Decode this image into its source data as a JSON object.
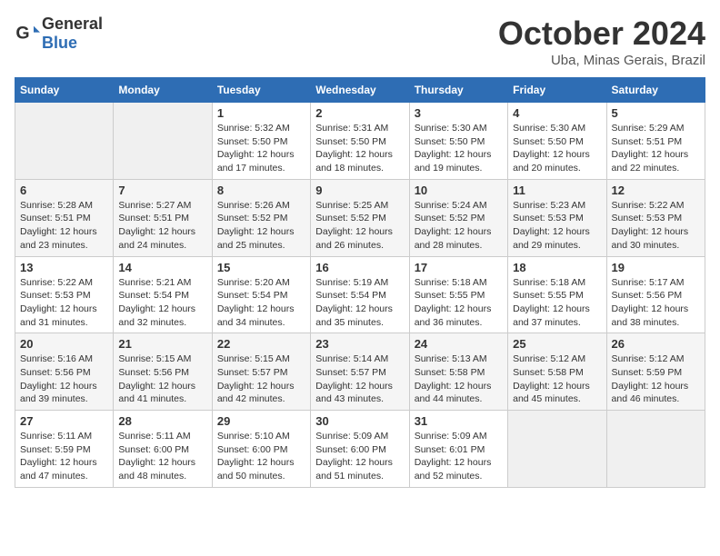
{
  "logo": {
    "line1": "General",
    "line2": "Blue"
  },
  "title": "October 2024",
  "subtitle": "Uba, Minas Gerais, Brazil",
  "days_of_week": [
    "Sunday",
    "Monday",
    "Tuesday",
    "Wednesday",
    "Thursday",
    "Friday",
    "Saturday"
  ],
  "weeks": [
    [
      null,
      null,
      {
        "day": "1",
        "sunrise": "Sunrise: 5:32 AM",
        "sunset": "Sunset: 5:50 PM",
        "daylight": "Daylight: 12 hours and 17 minutes."
      },
      {
        "day": "2",
        "sunrise": "Sunrise: 5:31 AM",
        "sunset": "Sunset: 5:50 PM",
        "daylight": "Daylight: 12 hours and 18 minutes."
      },
      {
        "day": "3",
        "sunrise": "Sunrise: 5:30 AM",
        "sunset": "Sunset: 5:50 PM",
        "daylight": "Daylight: 12 hours and 19 minutes."
      },
      {
        "day": "4",
        "sunrise": "Sunrise: 5:30 AM",
        "sunset": "Sunset: 5:50 PM",
        "daylight": "Daylight: 12 hours and 20 minutes."
      },
      {
        "day": "5",
        "sunrise": "Sunrise: 5:29 AM",
        "sunset": "Sunset: 5:51 PM",
        "daylight": "Daylight: 12 hours and 22 minutes."
      }
    ],
    [
      {
        "day": "6",
        "sunrise": "Sunrise: 5:28 AM",
        "sunset": "Sunset: 5:51 PM",
        "daylight": "Daylight: 12 hours and 23 minutes."
      },
      {
        "day": "7",
        "sunrise": "Sunrise: 5:27 AM",
        "sunset": "Sunset: 5:51 PM",
        "daylight": "Daylight: 12 hours and 24 minutes."
      },
      {
        "day": "8",
        "sunrise": "Sunrise: 5:26 AM",
        "sunset": "Sunset: 5:52 PM",
        "daylight": "Daylight: 12 hours and 25 minutes."
      },
      {
        "day": "9",
        "sunrise": "Sunrise: 5:25 AM",
        "sunset": "Sunset: 5:52 PM",
        "daylight": "Daylight: 12 hours and 26 minutes."
      },
      {
        "day": "10",
        "sunrise": "Sunrise: 5:24 AM",
        "sunset": "Sunset: 5:52 PM",
        "daylight": "Daylight: 12 hours and 28 minutes."
      },
      {
        "day": "11",
        "sunrise": "Sunrise: 5:23 AM",
        "sunset": "Sunset: 5:53 PM",
        "daylight": "Daylight: 12 hours and 29 minutes."
      },
      {
        "day": "12",
        "sunrise": "Sunrise: 5:22 AM",
        "sunset": "Sunset: 5:53 PM",
        "daylight": "Daylight: 12 hours and 30 minutes."
      }
    ],
    [
      {
        "day": "13",
        "sunrise": "Sunrise: 5:22 AM",
        "sunset": "Sunset: 5:53 PM",
        "daylight": "Daylight: 12 hours and 31 minutes."
      },
      {
        "day": "14",
        "sunrise": "Sunrise: 5:21 AM",
        "sunset": "Sunset: 5:54 PM",
        "daylight": "Daylight: 12 hours and 32 minutes."
      },
      {
        "day": "15",
        "sunrise": "Sunrise: 5:20 AM",
        "sunset": "Sunset: 5:54 PM",
        "daylight": "Daylight: 12 hours and 34 minutes."
      },
      {
        "day": "16",
        "sunrise": "Sunrise: 5:19 AM",
        "sunset": "Sunset: 5:54 PM",
        "daylight": "Daylight: 12 hours and 35 minutes."
      },
      {
        "day": "17",
        "sunrise": "Sunrise: 5:18 AM",
        "sunset": "Sunset: 5:55 PM",
        "daylight": "Daylight: 12 hours and 36 minutes."
      },
      {
        "day": "18",
        "sunrise": "Sunrise: 5:18 AM",
        "sunset": "Sunset: 5:55 PM",
        "daylight": "Daylight: 12 hours and 37 minutes."
      },
      {
        "day": "19",
        "sunrise": "Sunrise: 5:17 AM",
        "sunset": "Sunset: 5:56 PM",
        "daylight": "Daylight: 12 hours and 38 minutes."
      }
    ],
    [
      {
        "day": "20",
        "sunrise": "Sunrise: 5:16 AM",
        "sunset": "Sunset: 5:56 PM",
        "daylight": "Daylight: 12 hours and 39 minutes."
      },
      {
        "day": "21",
        "sunrise": "Sunrise: 5:15 AM",
        "sunset": "Sunset: 5:56 PM",
        "daylight": "Daylight: 12 hours and 41 minutes."
      },
      {
        "day": "22",
        "sunrise": "Sunrise: 5:15 AM",
        "sunset": "Sunset: 5:57 PM",
        "daylight": "Daylight: 12 hours and 42 minutes."
      },
      {
        "day": "23",
        "sunrise": "Sunrise: 5:14 AM",
        "sunset": "Sunset: 5:57 PM",
        "daylight": "Daylight: 12 hours and 43 minutes."
      },
      {
        "day": "24",
        "sunrise": "Sunrise: 5:13 AM",
        "sunset": "Sunset: 5:58 PM",
        "daylight": "Daylight: 12 hours and 44 minutes."
      },
      {
        "day": "25",
        "sunrise": "Sunrise: 5:12 AM",
        "sunset": "Sunset: 5:58 PM",
        "daylight": "Daylight: 12 hours and 45 minutes."
      },
      {
        "day": "26",
        "sunrise": "Sunrise: 5:12 AM",
        "sunset": "Sunset: 5:59 PM",
        "daylight": "Daylight: 12 hours and 46 minutes."
      }
    ],
    [
      {
        "day": "27",
        "sunrise": "Sunrise: 5:11 AM",
        "sunset": "Sunset: 5:59 PM",
        "daylight": "Daylight: 12 hours and 47 minutes."
      },
      {
        "day": "28",
        "sunrise": "Sunrise: 5:11 AM",
        "sunset": "Sunset: 6:00 PM",
        "daylight": "Daylight: 12 hours and 48 minutes."
      },
      {
        "day": "29",
        "sunrise": "Sunrise: 5:10 AM",
        "sunset": "Sunset: 6:00 PM",
        "daylight": "Daylight: 12 hours and 50 minutes."
      },
      {
        "day": "30",
        "sunrise": "Sunrise: 5:09 AM",
        "sunset": "Sunset: 6:00 PM",
        "daylight": "Daylight: 12 hours and 51 minutes."
      },
      {
        "day": "31",
        "sunrise": "Sunrise: 5:09 AM",
        "sunset": "Sunset: 6:01 PM",
        "daylight": "Daylight: 12 hours and 52 minutes."
      },
      null,
      null
    ]
  ]
}
